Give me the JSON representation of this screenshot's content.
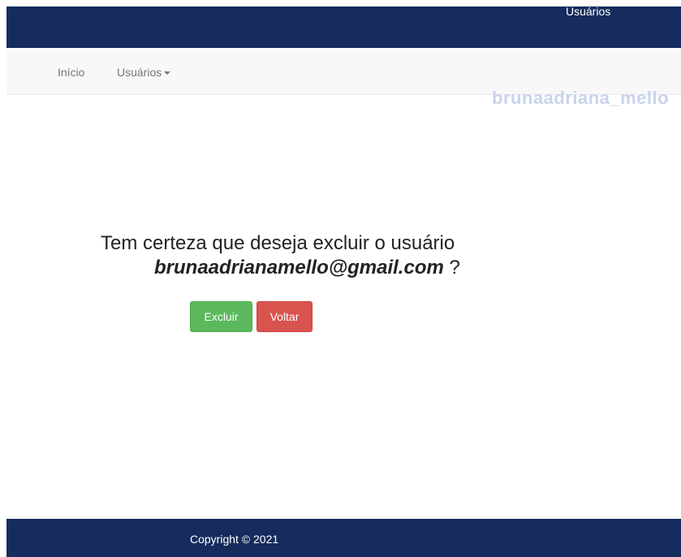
{
  "header": {
    "title": "Usuários",
    "background": "#152c5c"
  },
  "navbar": {
    "items": [
      {
        "label": "Início"
      },
      {
        "label": "Usuários",
        "has_dropdown": true,
        "icon": "caret-down-icon"
      }
    ]
  },
  "ghost_text": "brunaadriana_mello",
  "confirm": {
    "question": "Tem certeza que deseja excluir o usuário",
    "email": "brunaadrianamello@gmail.com",
    "suffix": " ?",
    "excluir_label": "Excluir",
    "voltar_label": "Voltar",
    "excluir_color": "#5cb85c",
    "voltar_color": "#d9534f"
  },
  "footer": {
    "copyright": "Copyright © 2021"
  }
}
